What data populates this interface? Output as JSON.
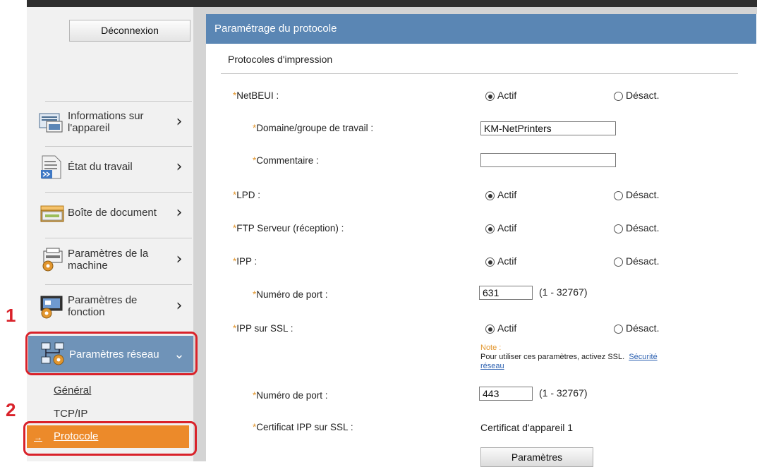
{
  "sidebar": {
    "logout_label": "Déconnexion",
    "items": [
      {
        "label": "Informations sur l'appareil",
        "icon": "device-info-icon"
      },
      {
        "label": "État du travail",
        "icon": "job-status-icon"
      },
      {
        "label": "Boîte de document",
        "icon": "document-box-icon"
      },
      {
        "label": "Paramètres de la machine",
        "icon": "machine-settings-icon"
      },
      {
        "label": "Paramètres de fonction",
        "icon": "function-settings-icon"
      },
      {
        "label": "Paramètres réseau",
        "icon": "network-settings-icon"
      }
    ],
    "sub_items": [
      "Général",
      "TCP/IP",
      "Protocole"
    ]
  },
  "callouts": [
    "1",
    "2"
  ],
  "main": {
    "header": "Paramétrage du protocole",
    "section_title": "Protocoles d'impression",
    "required_mark": "*",
    "rows": {
      "netbeui": {
        "label": "NetBEUI :",
        "on": "Actif",
        "off": "Désact."
      },
      "domain": {
        "label": "Domaine/groupe de travail :",
        "value": "KM-NetPrinters"
      },
      "comment": {
        "label": "Commentaire :",
        "value": ""
      },
      "lpd": {
        "label": "LPD :",
        "on": "Actif",
        "off": "Désact."
      },
      "ftp": {
        "label": "FTP Serveur (réception) :",
        "on": "Actif",
        "off": "Désact."
      },
      "ipp": {
        "label": "IPP :",
        "on": "Actif",
        "off": "Désact."
      },
      "ipp_port": {
        "label": "Numéro de port :",
        "value": "631",
        "range": "(1 - 32767)"
      },
      "ipp_ssl": {
        "label": "IPP sur SSL :",
        "on": "Actif",
        "off": "Désact."
      },
      "note": {
        "title": "Note :",
        "text": "Pour utiliser ces paramètres, activez SSL.",
        "link1": "Sécurité",
        "link2": "réseau"
      },
      "ssl_port": {
        "label": "Numéro de port :",
        "value": "443",
        "range": "(1 - 32767)"
      },
      "cert": {
        "label": "Certificat IPP sur SSL :",
        "value": "Certificat d'appareil 1"
      }
    },
    "settings_button": "Paramètres"
  },
  "colors": {
    "header": "#5a86b4",
    "accent_orange": "#ec8a2a",
    "highlight_red": "#d9222a",
    "active_nav": "#6f93b8"
  }
}
